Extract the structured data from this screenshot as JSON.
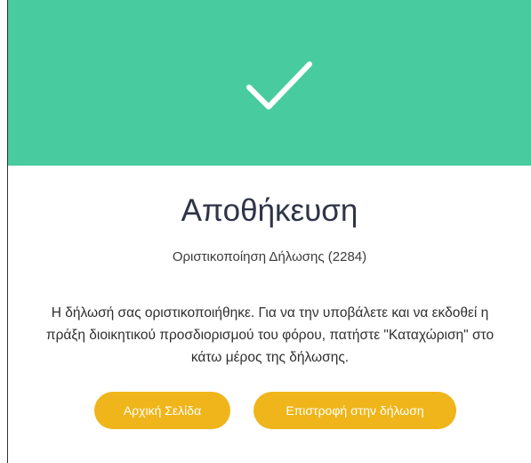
{
  "header": {
    "icon": "checkmark-icon",
    "background_color": "#48cb9f"
  },
  "dialog": {
    "title": "Αποθήκευση",
    "subtitle": "Οριστικοποίηση Δήλωσης (2284)",
    "message": "Η δήλωσή σας οριστικοποιήθηκε. Για να την υποβάλετε και να εκδοθεί η πράξη διοικητικού προσδιορισμού του φόρου, πατήστε \"Καταχώριση\" στο κάτω μέρος της δήλωσης."
  },
  "actions": {
    "home_label": "Αρχική Σελίδα",
    "return_label": "Επιστροφή στην δήλωση",
    "button_color": "#efb51a"
  }
}
